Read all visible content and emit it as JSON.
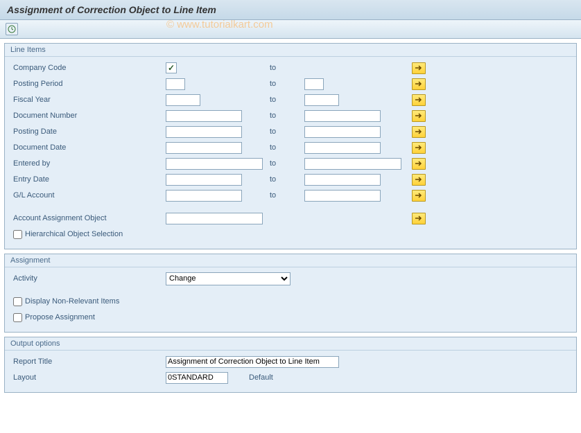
{
  "title": "Assignment of Correction Object to Line Item",
  "watermark": "© www.tutorialkart.com",
  "groups": {
    "lineItems": {
      "title": "Line Items",
      "fields": {
        "companyCode": {
          "label": "Company Code",
          "to": "to"
        },
        "postingPeriod": {
          "label": "Posting Period",
          "to": "to"
        },
        "fiscalYear": {
          "label": "Fiscal Year",
          "to": "to"
        },
        "documentNumber": {
          "label": "Document Number",
          "to": "to"
        },
        "postingDate": {
          "label": "Posting Date",
          "to": "to"
        },
        "documentDate": {
          "label": "Document Date",
          "to": "to"
        },
        "enteredBy": {
          "label": "Entered by",
          "to": "to"
        },
        "entryDate": {
          "label": "Entry Date",
          "to": "to"
        },
        "glAccount": {
          "label": "G/L Account",
          "to": "to"
        },
        "acctAssignObj": {
          "label": "Account Assignment Object"
        },
        "hierarchical": {
          "label": "Hierarchical Object Selection"
        }
      }
    },
    "assignment": {
      "title": "Assignment",
      "activityLabel": "Activity",
      "activityValue": "Change",
      "displayNonRelevant": "Display Non-Relevant Items",
      "proposeAssignment": "Propose Assignment"
    },
    "output": {
      "title": "Output options",
      "reportTitleLabel": "Report Title",
      "reportTitleValue": "Assignment of Correction Object to Line Item",
      "layoutLabel": "Layout",
      "layoutValue": "0STANDARD",
      "layoutDefault": "Default"
    }
  }
}
